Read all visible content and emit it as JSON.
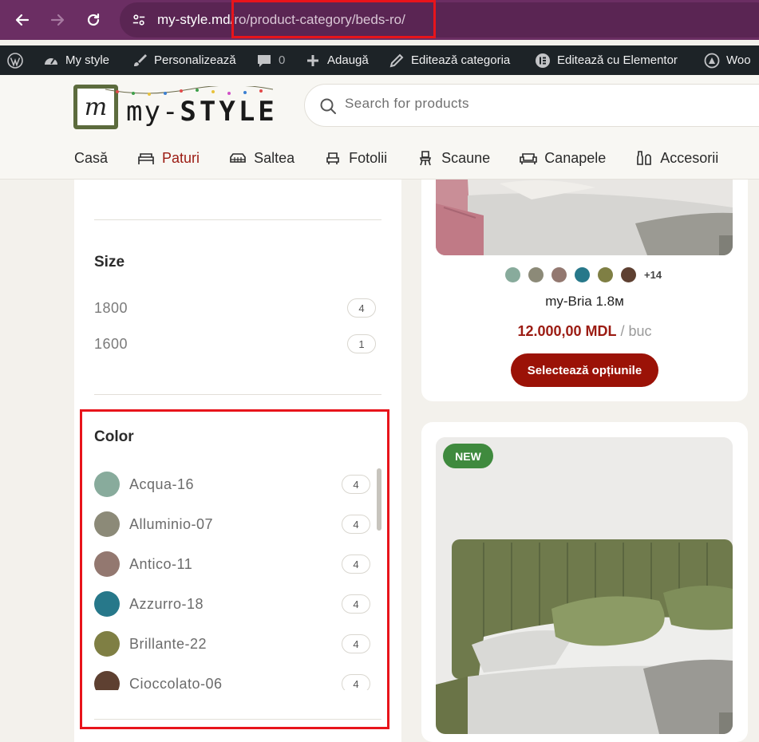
{
  "browser": {
    "url_host": "my-style.md",
    "url_path": "/ro/product-category/beds-ro/"
  },
  "admin_bar": {
    "items": [
      {
        "label": "My style"
      },
      {
        "label": "Personalizează"
      },
      {
        "label": "0"
      },
      {
        "label": "Adaugă"
      },
      {
        "label": "Editează categoria"
      },
      {
        "label": "Editează cu Elementor"
      },
      {
        "label": "Woo"
      }
    ]
  },
  "header": {
    "logo_small": "my-",
    "logo_big": "STYLE",
    "search_placeholder": "Search for products",
    "menu": [
      {
        "label": "Casă",
        "icon": "none"
      },
      {
        "label": "Paturi",
        "icon": "bed-icon",
        "active": true
      },
      {
        "label": "Saltea",
        "icon": "mattress-icon"
      },
      {
        "label": "Fotolii",
        "icon": "armchair-icon"
      },
      {
        "label": "Scaune",
        "icon": "chair-icon"
      },
      {
        "label": "Canapele",
        "icon": "sofa-icon"
      },
      {
        "label": "Accesorii",
        "icon": "vases-icon"
      }
    ],
    "active_color": "#9b1b12"
  },
  "sidebar": {
    "size": {
      "title": "Size",
      "options": [
        {
          "label": "1800",
          "count": "4"
        },
        {
          "label": "1600",
          "count": "1"
        }
      ]
    },
    "color": {
      "title": "Color",
      "options": [
        {
          "label": "Acqua-16",
          "count": "4",
          "hex": "#88ab9c"
        },
        {
          "label": "Alluminio-07",
          "count": "4",
          "hex": "#8c8a78"
        },
        {
          "label": "Antico-11",
          "count": "4",
          "hex": "#937870"
        },
        {
          "label": "Azzurro-18",
          "count": "4",
          "hex": "#27788a"
        },
        {
          "label": "Brillante-22",
          "count": "4",
          "hex": "#7f7f44"
        },
        {
          "label": "Cioccolato-06",
          "count": "4",
          "hex": "#5e4031"
        }
      ]
    }
  },
  "products": [
    {
      "name": "my-Bria 1.8м",
      "price": "12.000,00 MDL",
      "unit": "/ buc",
      "swatches": [
        "#88ab9c",
        "#8c8a78",
        "#937870",
        "#27788a",
        "#7f7f44",
        "#5e4031"
      ],
      "more_colors": "+14",
      "button": "Selectează opțiunile"
    },
    {
      "badge": "NEW"
    }
  ]
}
